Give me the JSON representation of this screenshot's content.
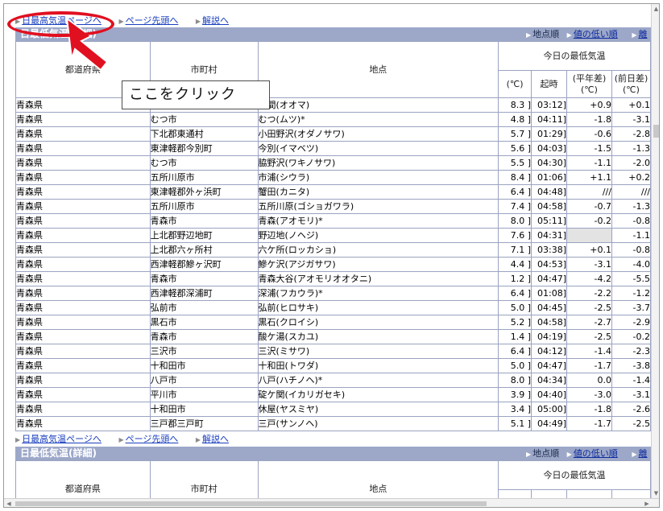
{
  "nav": {
    "links": [
      "日最高気温ページへ",
      "ページ先頭へ",
      "解説へ"
    ]
  },
  "section": {
    "title": "日最低気温(詳細)",
    "sort_plain": "地点順",
    "sort_link": "値の低い順",
    "sort_cut": "離"
  },
  "table": {
    "col_pref": "都道府県",
    "col_city": "市町村",
    "col_point": "地点",
    "group_title": "今日の最低気温",
    "sub_value": "(℃)",
    "sub_time": "起時",
    "sub_normal_1": "(平年差)",
    "sub_normal_2": "(℃)",
    "sub_prev_1": "(前日差)",
    "sub_prev_2": "(℃)",
    "rows": [
      {
        "pref": "青森県",
        "city": "",
        "point": "大間(オオマ)",
        "val": "8.3 ]",
        "time": "03:12]",
        "normal": "+0.9",
        "prev": "+0.1"
      },
      {
        "pref": "青森県",
        "city": "むつ市",
        "point": "むつ(ムツ)*",
        "val": "4.8 ]",
        "time": "04:11]",
        "normal": "-1.8",
        "prev": "-3.1"
      },
      {
        "pref": "青森県",
        "city": "下北郡東通村",
        "point": "小田野沢(オダノサワ)",
        "val": "5.7 ]",
        "time": "01:29]",
        "normal": "-0.6",
        "prev": "-2.8"
      },
      {
        "pref": "青森県",
        "city": "東津軽郡今別町",
        "point": "今別(イマベツ)",
        "val": "5.6 ]",
        "time": "04:03]",
        "normal": "-1.5",
        "prev": "-1.3"
      },
      {
        "pref": "青森県",
        "city": "むつ市",
        "point": "脇野沢(ワキノサワ)",
        "val": "5.5 ]",
        "time": "04:30]",
        "normal": "-1.1",
        "prev": "-2.0"
      },
      {
        "pref": "青森県",
        "city": "五所川原市",
        "point": "市浦(シウラ)",
        "val": "8.4 ]",
        "time": "01:06]",
        "normal": "+1.1",
        "prev": "+0.2"
      },
      {
        "pref": "青森県",
        "city": "東津軽郡外ヶ浜町",
        "point": "蟹田(カニタ)",
        "val": "6.4 ]",
        "time": "04:48]",
        "normal": "///",
        "prev": "///"
      },
      {
        "pref": "青森県",
        "city": "五所川原市",
        "point": "五所川原(ゴショガワラ)",
        "val": "7.4 ]",
        "time": "04:58]",
        "normal": "-0.7",
        "prev": "-1.3"
      },
      {
        "pref": "青森県",
        "city": "青森市",
        "point": "青森(アオモリ)*",
        "val": "8.0 ]",
        "time": "05:11]",
        "normal": "-0.2",
        "prev": "-0.8"
      },
      {
        "pref": "青森県",
        "city": "上北郡野辺地町",
        "point": "野辺地(ノヘジ)",
        "val": "7.6 ]",
        "time": "04:31]",
        "normal": "",
        "prev": "-1.1",
        "gray": true
      },
      {
        "pref": "青森県",
        "city": "上北郡六ヶ所村",
        "point": "六ケ所(ロッカショ)",
        "val": "7.1 ]",
        "time": "03:38]",
        "normal": "+0.1",
        "prev": "-0.8"
      },
      {
        "pref": "青森県",
        "city": "西津軽郡鰺ヶ沢町",
        "point": "鰺ケ沢(アジガサワ)",
        "val": "4.4 ]",
        "time": "04:53]",
        "normal": "-3.1",
        "prev": "-4.0"
      },
      {
        "pref": "青森県",
        "city": "青森市",
        "point": "青森大谷(アオモリオオタニ)",
        "val": "1.2 ]",
        "time": "04:47]",
        "normal": "-4.2",
        "prev": "-5.5"
      },
      {
        "pref": "青森県",
        "city": "西津軽郡深浦町",
        "point": "深浦(フカウラ)*",
        "val": "6.4 ]",
        "time": "01:08]",
        "normal": "-2.2",
        "prev": "-1.2"
      },
      {
        "pref": "青森県",
        "city": "弘前市",
        "point": "弘前(ヒロサキ)",
        "val": "5.0 ]",
        "time": "04:45]",
        "normal": "-2.5",
        "prev": "-3.7"
      },
      {
        "pref": "青森県",
        "city": "黒石市",
        "point": "黒石(クロイシ)",
        "val": "5.2 ]",
        "time": "04:58]",
        "normal": "-2.7",
        "prev": "-2.9"
      },
      {
        "pref": "青森県",
        "city": "青森市",
        "point": "酸ケ湯(スカユ)",
        "val": "1.4 ]",
        "time": "04:19]",
        "normal": "-2.5",
        "prev": "-0.2"
      },
      {
        "pref": "青森県",
        "city": "三沢市",
        "point": "三沢(ミサワ)",
        "val": "6.4 ]",
        "time": "04:12]",
        "normal": "-1.4",
        "prev": "-2.3"
      },
      {
        "pref": "青森県",
        "city": "十和田市",
        "point": "十和田(トワダ)",
        "val": "5.0 ]",
        "time": "04:47]",
        "normal": "-1.7",
        "prev": "-3.8"
      },
      {
        "pref": "青森県",
        "city": "八戸市",
        "point": "八戸(ハチノヘ)*",
        "val": "8.0 ]",
        "time": "04:34]",
        "normal": "0.0",
        "prev": "-1.4"
      },
      {
        "pref": "青森県",
        "city": "平川市",
        "point": "碇ケ関(イカリガセキ)",
        "val": "3.9 ]",
        "time": "04:40]",
        "normal": "-3.0",
        "prev": "-3.1"
      },
      {
        "pref": "青森県",
        "city": "十和田市",
        "point": "休屋(ヤスミヤ)",
        "val": "3.4 ]",
        "time": "05:00]",
        "normal": "-1.8",
        "prev": "-2.6"
      },
      {
        "pref": "青森県",
        "city": "三戸郡三戸町",
        "point": "三戸(サンノヘ)",
        "val": "5.1 ]",
        "time": "04:49]",
        "normal": "-1.7",
        "prev": "-2.5"
      }
    ]
  },
  "callout": {
    "text": "ここをクリック",
    "accent": "#e01020"
  }
}
